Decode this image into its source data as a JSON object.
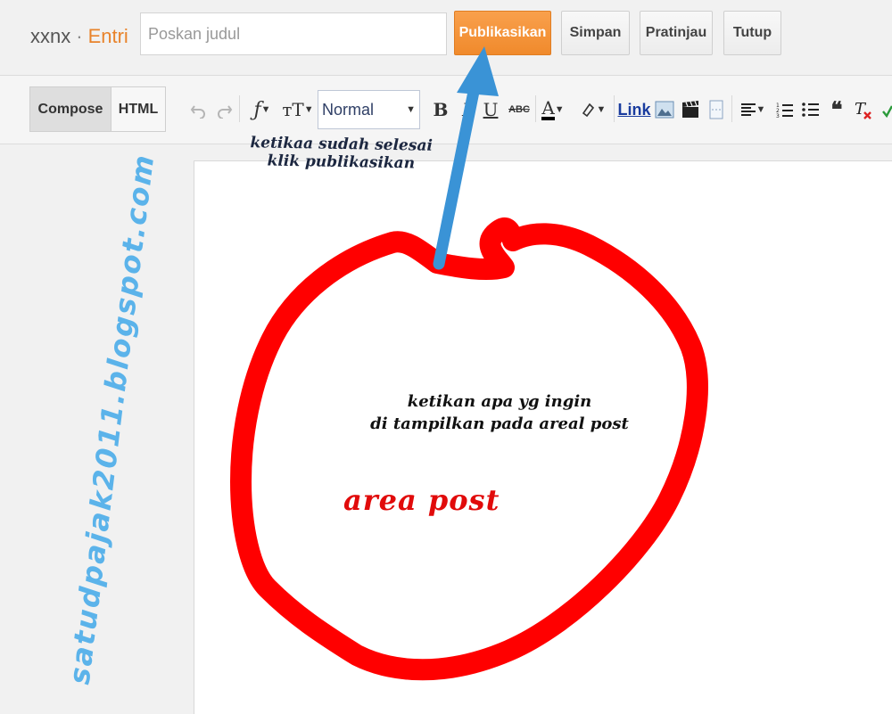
{
  "header": {
    "blog_name": "xxnx",
    "separator": "·",
    "section": "Entri",
    "title_placeholder": "Poskan judul",
    "buttons": {
      "publish": "Publikasikan",
      "save": "Simpan",
      "preview": "Pratinjau",
      "close": "Tutup"
    }
  },
  "toolbar": {
    "modes": {
      "compose": "Compose",
      "html": "HTML"
    },
    "font_size_value": "Normal",
    "link_label": "Link",
    "icons": [
      "undo-icon",
      "redo-icon",
      "font-family-icon",
      "font-size-icon",
      "bold-icon",
      "italic-icon",
      "underline-icon",
      "strikethrough-icon",
      "text-color-icon",
      "highlight-color-icon",
      "link",
      "image-icon",
      "video-icon",
      "jump-break-icon",
      "align-icon",
      "numbered-list-icon",
      "bulleted-list-icon",
      "quote-icon",
      "remove-format-icon"
    ],
    "strike_text": "ABC",
    "bold_text": "B",
    "text_color_text": "A",
    "quote_text": "❝"
  },
  "annotations": {
    "top_note_line1": "ketikaa sudah selesai",
    "top_note_line2": "klik publikasikan",
    "mid_note_line1": "ketikan apa yg ingin",
    "mid_note_line2": "di tampilkan pada areal post",
    "area_label": "area post",
    "watermark": "satudpajak2011.blogspot.com"
  },
  "colors": {
    "publish_orange": "#f08a2c",
    "entri_orange": "#e8832b",
    "circle_red": "#ff0000",
    "arrow_blue": "#3a93d6",
    "watermark_blue": "#5bb3ea"
  }
}
